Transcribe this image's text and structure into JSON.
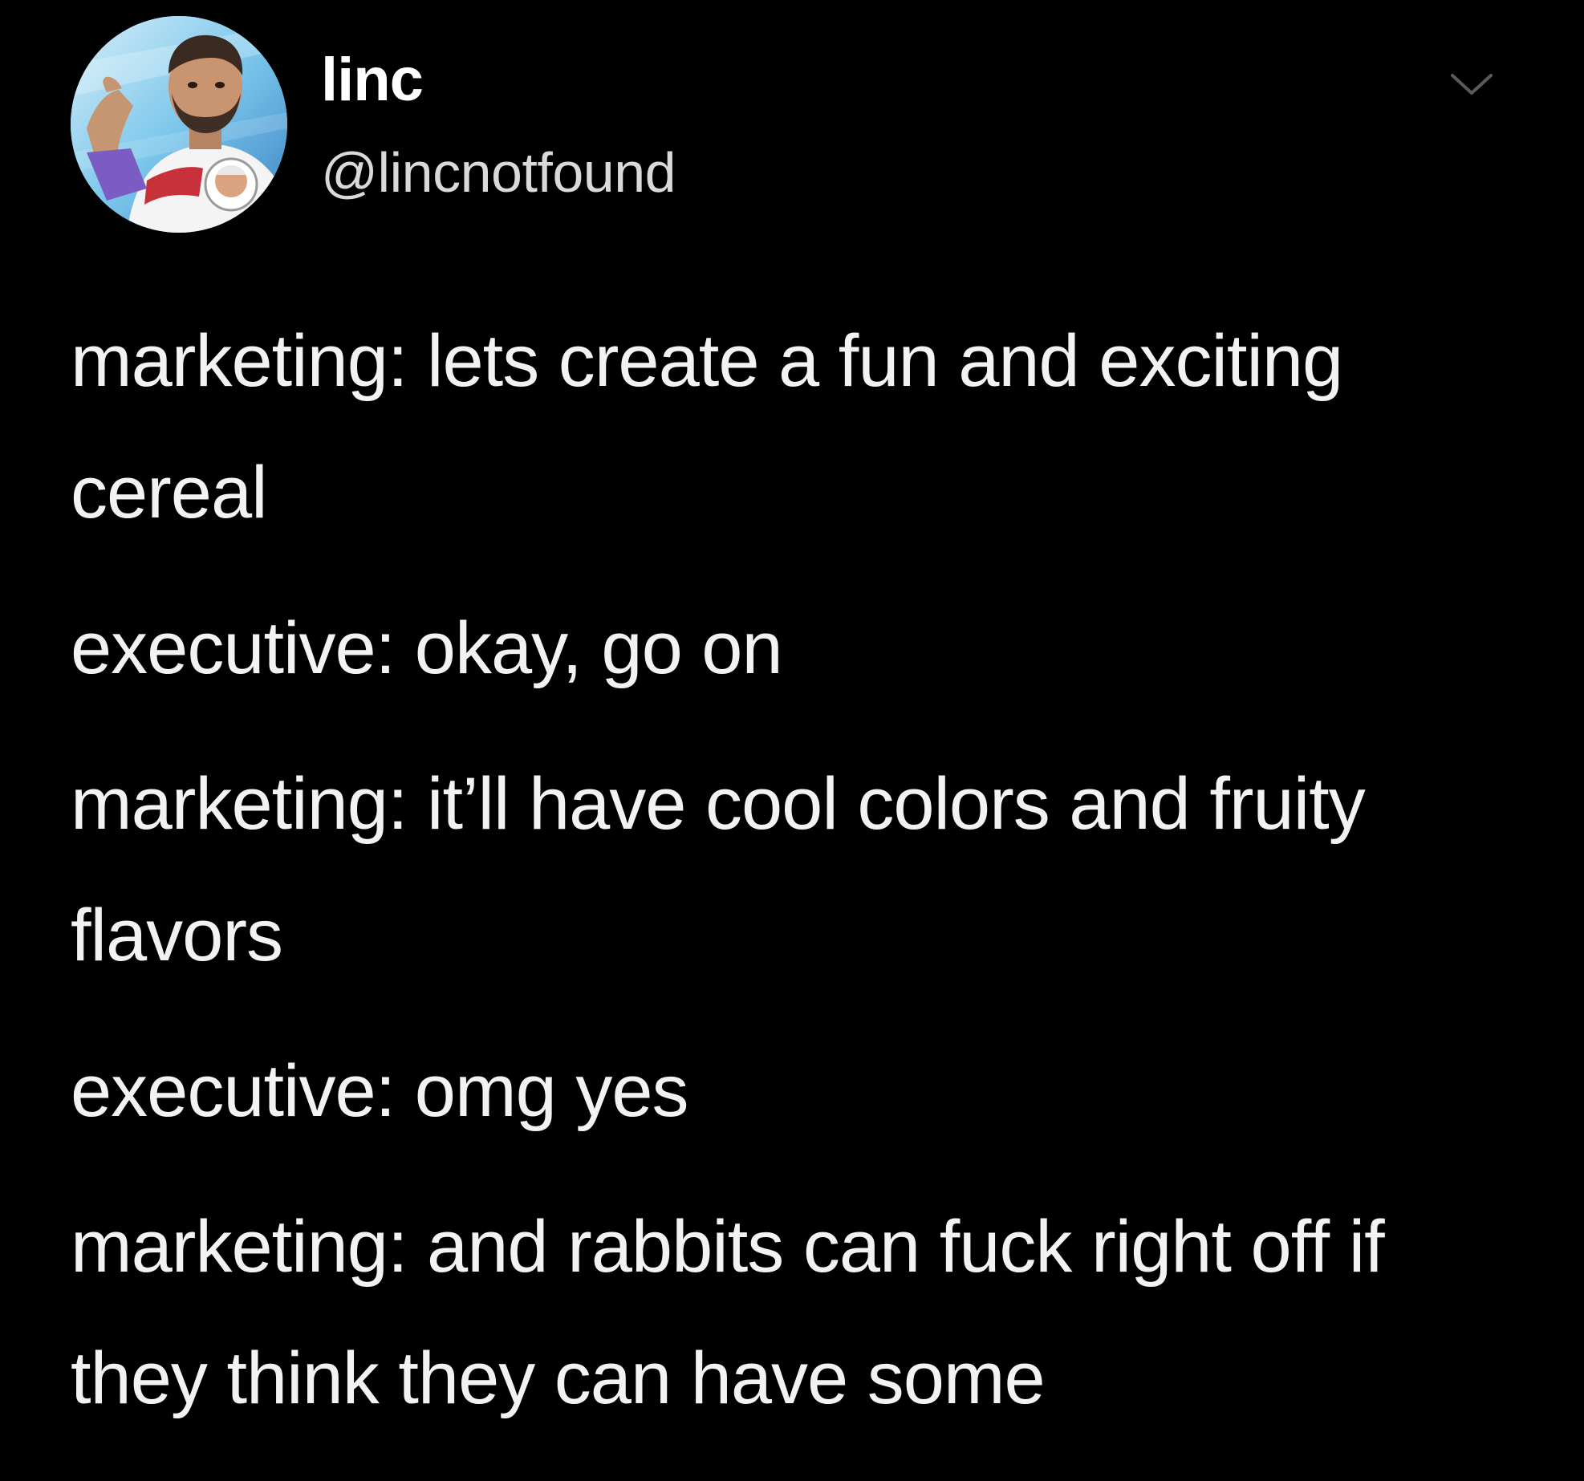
{
  "user": {
    "display_name": "linc",
    "handle": "@lincnotfound",
    "avatar_icon": "profile-photo"
  },
  "header": {
    "menu_icon": "chevron-down-icon"
  },
  "tweet": {
    "lines": [
      "marketing: lets create a fun and exciting cereal",
      "executive: okay, go on",
      "marketing: it’ll have cool colors and fruity flavors",
      "executive: omg yes",
      "marketing: and rabbits can fuck right off if they think they can have some"
    ]
  },
  "colors": {
    "background": "#000000",
    "text": "#f2f2f2",
    "handle": "#d9d9d9"
  }
}
